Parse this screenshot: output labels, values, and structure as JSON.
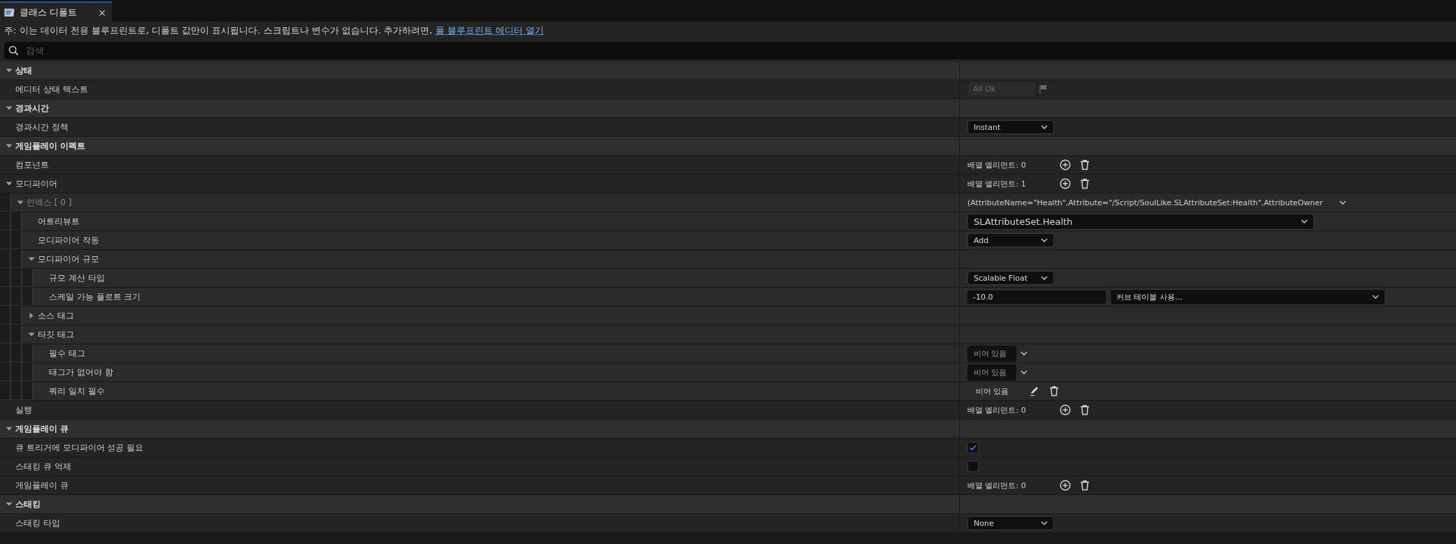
{
  "tab": {
    "title": "클래스 디폴트",
    "close": "×"
  },
  "notice": {
    "text": "주: 이는 데이터 전용 블루프린트로, 디폴트 값만이 표시됩니다. 스크립트나 변수가 없습니다. 추가하려면, ",
    "link": "풀 블루프린트 에디터 열기"
  },
  "search": {
    "placeholder": "검색"
  },
  "rows": [
    {
      "kind": "category",
      "label": "상태",
      "expanded": true,
      "children": [
        {
          "kind": "property",
          "label": "에디터 상태 텍스트",
          "value": {
            "kind": "status",
            "text": "All Ok"
          }
        }
      ]
    },
    {
      "kind": "category",
      "label": "경과시간",
      "expanded": true,
      "children": [
        {
          "kind": "property",
          "label": "경과시간 정책",
          "value": {
            "kind": "dropdown",
            "text": "Instant"
          }
        }
      ]
    },
    {
      "kind": "category",
      "label": "게임플레이 이펙트",
      "expanded": true,
      "children": [
        {
          "kind": "property",
          "label": "컴포넌트",
          "value": {
            "kind": "array",
            "text": "배열 엘리먼트: 0"
          }
        },
        {
          "kind": "property",
          "label": "모디파이어",
          "expanded": true,
          "value": {
            "kind": "array",
            "text": "배열 엘리먼트: 1"
          },
          "children": [
            {
              "kind": "index",
              "label": "인덱스 [ 0 ]",
              "expanded": true,
              "value": {
                "kind": "summary",
                "text": "(AttributeName=\"Health\",Attribute=\"/Script/SoulLike.SLAttributeSet:Health\",AttributeOwner"
              },
              "children": [
                {
                  "kind": "property",
                  "label": "어트리뷰트",
                  "value": {
                    "kind": "wide_dropdown",
                    "text": "SLAttributeSet.Health"
                  }
                },
                {
                  "kind": "property",
                  "label": "모디파이어 작동",
                  "value": {
                    "kind": "dropdown",
                    "text": "Add"
                  }
                },
                {
                  "kind": "property",
                  "label": "모디파이어 규모",
                  "expanded": true,
                  "children": [
                    {
                      "kind": "property",
                      "label": "규모 계산 타입",
                      "value": {
                        "kind": "dropdown",
                        "text": "Scalable Float"
                      }
                    },
                    {
                      "kind": "property",
                      "label": "스케일 가능 플로트 크기",
                      "value": {
                        "kind": "float_curve",
                        "number": "-10.0",
                        "curve": "커브 테이블 사용..."
                      }
                    }
                  ]
                },
                {
                  "kind": "property",
                  "label": "소스 태그",
                  "expanded": false
                },
                {
                  "kind": "property",
                  "label": "타깃 태그",
                  "expanded": true,
                  "children": [
                    {
                      "kind": "property",
                      "label": "필수 태그",
                      "value": {
                        "kind": "tag",
                        "text": "비어 있음"
                      }
                    },
                    {
                      "kind": "property",
                      "label": "태그가 없어야 함",
                      "value": {
                        "kind": "tag",
                        "text": "비어 있음"
                      }
                    },
                    {
                      "kind": "property",
                      "label": "쿼리 일치 필수",
                      "value": {
                        "kind": "tag_query",
                        "text": "비어 있음"
                      }
                    }
                  ]
                }
              ]
            }
          ]
        },
        {
          "kind": "property",
          "label": "실행",
          "value": {
            "kind": "array",
            "text": "배열 엘리먼트: 0"
          }
        }
      ]
    },
    {
      "kind": "category",
      "label": "게임플레이 큐",
      "expanded": true,
      "children": [
        {
          "kind": "property",
          "label": "큐 트리거에 모디파이어 성공 필요",
          "value": {
            "kind": "checkbox",
            "checked": true
          }
        },
        {
          "kind": "property",
          "label": "스태킹 큐 억제",
          "value": {
            "kind": "checkbox",
            "checked": false
          }
        },
        {
          "kind": "property",
          "label": "게임플레이 큐",
          "value": {
            "kind": "array",
            "text": "배열 엘리먼트: 0"
          }
        }
      ]
    },
    {
      "kind": "category",
      "label": "스태킹",
      "expanded": true,
      "children": [
        {
          "kind": "property",
          "label": "스태킹 타입",
          "value": {
            "kind": "dropdown",
            "text": "None"
          }
        }
      ]
    }
  ]
}
